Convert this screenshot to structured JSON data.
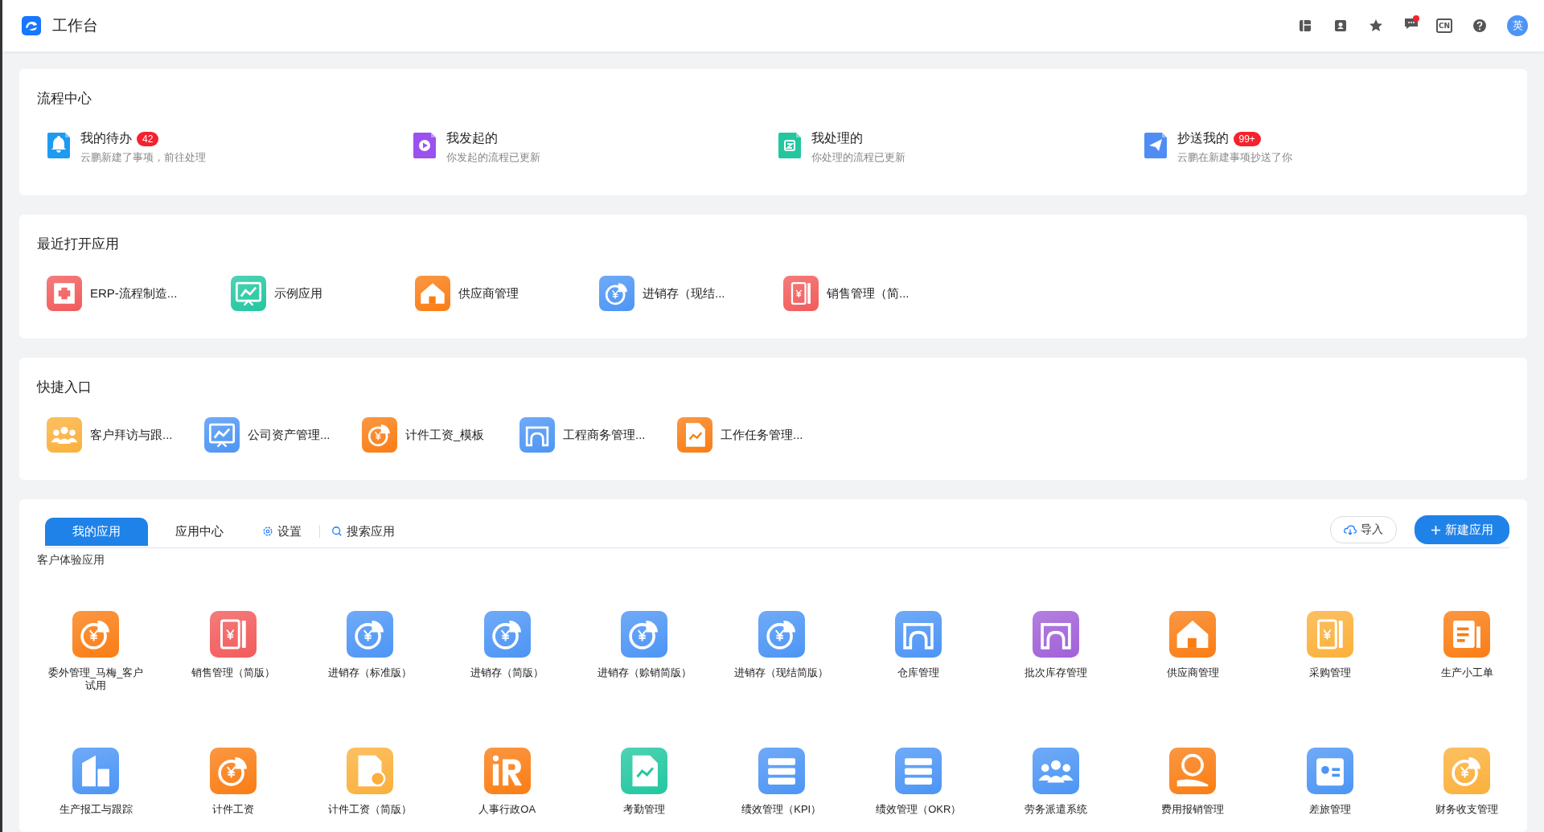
{
  "header": {
    "title": "工作台",
    "tools": [
      {
        "kind": "layout"
      },
      {
        "kind": "contacts"
      },
      {
        "kind": "star"
      },
      {
        "kind": "message",
        "dot": true
      },
      {
        "kind": "lang",
        "text": "CN"
      },
      {
        "kind": "help"
      }
    ],
    "avatar": "英"
  },
  "process_center": {
    "title": "流程中心",
    "items": [
      {
        "kind": "bell",
        "color": "#1e9bf0",
        "title": "我的待办",
        "badge": "42",
        "subtitle": "云鹏新建了事项，前往处理"
      },
      {
        "kind": "play",
        "color": "#9b51f0",
        "title": "我发起的",
        "subtitle": "你发起的流程已更新"
      },
      {
        "kind": "done",
        "color": "#22c7a0",
        "title": "我处理的",
        "subtitle": "你处理的流程已更新"
      },
      {
        "kind": "send",
        "color": "#4f8df5",
        "title": "抄送我的",
        "badge": "99+",
        "subtitle": "云鹏在新建事项抄送了你"
      }
    ]
  },
  "recent_apps": {
    "title": "最近打开应用",
    "items": [
      {
        "kind": "erp",
        "color": "#f25b5b",
        "label": "ERP-流程制造..."
      },
      {
        "kind": "chart",
        "color": "#22c7a0",
        "label": "示例应用"
      },
      {
        "kind": "house",
        "color": "#fa7d14",
        "label": "供应商管理"
      },
      {
        "kind": "pie",
        "color": "#4c95f5",
        "label": "进销存（现结..."
      },
      {
        "kind": "ledger",
        "color": "#f25b5b",
        "label": "销售管理（简..."
      }
    ]
  },
  "shortcuts": {
    "title": "快捷入口",
    "items": [
      {
        "kind": "people",
        "color": "#fbb03b",
        "label": "客户拜访与跟..."
      },
      {
        "kind": "chart",
        "color": "#4c95f5",
        "label": "公司资产管理..."
      },
      {
        "kind": "pie",
        "color": "#fa7d14",
        "label": "计件工资_模板"
      },
      {
        "kind": "arch",
        "color": "#4c95f5",
        "label": "工程商务管理..."
      },
      {
        "kind": "doc",
        "color": "#fa7d14",
        "label": "工作任务管理..."
      }
    ]
  },
  "apps": {
    "tabs": [
      {
        "label": "我的应用",
        "selected": true
      },
      {
        "label": "应用中心",
        "selected": false
      }
    ],
    "settings": "设置",
    "search": "搜索应用",
    "import": "导入",
    "new_app": "新建应用",
    "group": "客户体验应用",
    "items": [
      {
        "kind": "pie",
        "color": "#fa7d14",
        "label": "委外管理_马梅_客户试用"
      },
      {
        "kind": "ledger",
        "color": "#f25b5b",
        "label": "销售管理（简版）"
      },
      {
        "kind": "pie",
        "color": "#4c95f5",
        "label": "进销存（标准版）"
      },
      {
        "kind": "pie",
        "color": "#4c95f5",
        "label": "进销存（简版）"
      },
      {
        "kind": "pie",
        "color": "#4c95f5",
        "label": "进销存（赊销简版）"
      },
      {
        "kind": "pie",
        "color": "#4c95f5",
        "label": "进销存（现结简版）"
      },
      {
        "kind": "arch",
        "color": "#4c95f5",
        "label": "仓库管理"
      },
      {
        "kind": "arch",
        "color": "#a160d8",
        "label": "批次库存管理"
      },
      {
        "kind": "house",
        "color": "#fa7d14",
        "label": "供应商管理"
      },
      {
        "kind": "ledger",
        "color": "#fbb03b",
        "label": "采购管理"
      },
      {
        "kind": "doc2",
        "color": "#fa7d14",
        "label": "生产小工单"
      },
      {
        "kind": "building",
        "color": "#4c95f5",
        "label": "生产报工与跟踪"
      },
      {
        "kind": "pie",
        "color": "#fa7d14",
        "label": "计件工资"
      },
      {
        "kind": "coin",
        "color": "#fbb03b",
        "label": "计件工资（简版）"
      },
      {
        "kind": "ir",
        "color": "#fa7d14",
        "label": "人事行政OA"
      },
      {
        "kind": "doc",
        "color": "#22c7a0",
        "label": "考勤管理"
      },
      {
        "kind": "server",
        "color": "#4c95f5",
        "label": "绩效管理（KPI）"
      },
      {
        "kind": "server",
        "color": "#4c95f5",
        "label": "绩效管理（OKR）"
      },
      {
        "kind": "people",
        "color": "#4c95f5",
        "label": "劳务派遣系统"
      },
      {
        "kind": "hand",
        "color": "#fa7d14",
        "label": "费用报销管理"
      },
      {
        "kind": "idcard",
        "color": "#4c95f5",
        "label": "差旅管理"
      },
      {
        "kind": "pie",
        "color": "#fbb03b",
        "label": "财务收支管理"
      }
    ]
  }
}
